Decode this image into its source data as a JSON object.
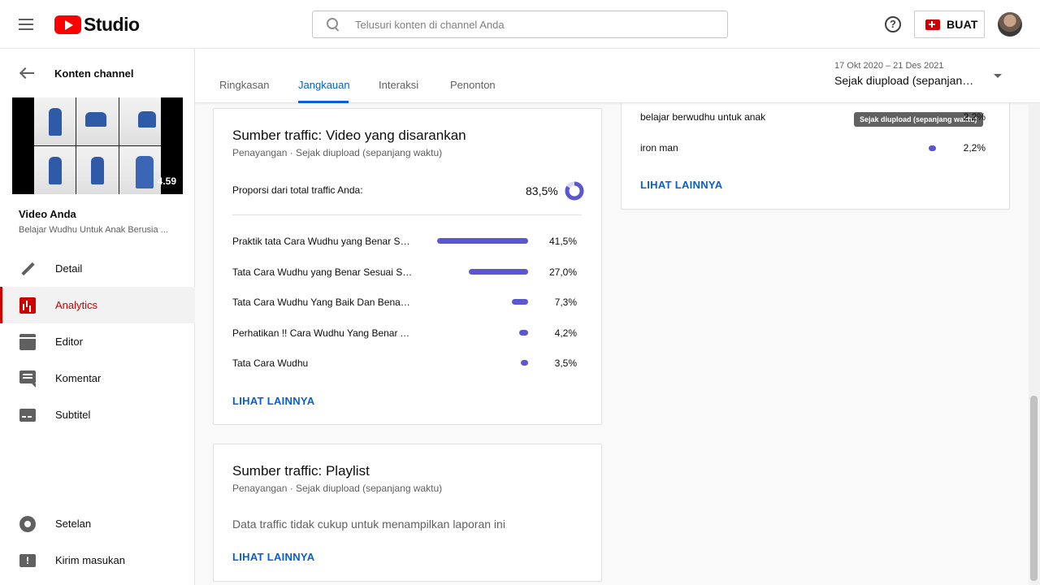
{
  "app": {
    "logo_text": "Studio"
  },
  "search": {
    "placeholder": "Telusuri konten di channel Anda"
  },
  "header": {
    "help": "?",
    "create_label": "BUAT"
  },
  "sidebar": {
    "back_label": "Konten channel",
    "thumbnail_duration": "4.59",
    "your_video_label": "Video Anda",
    "video_title": "Belajar Wudhu Untuk Anak Berusia ...",
    "items": [
      {
        "label": "Detail",
        "icon": "pencil-icon"
      },
      {
        "label": "Analytics",
        "icon": "analytics-icon"
      },
      {
        "label": "Editor",
        "icon": "editor-icon"
      },
      {
        "label": "Komentar",
        "icon": "comment-icon"
      },
      {
        "label": "Subtitel",
        "icon": "subtitle-icon"
      }
    ],
    "bottom_items": [
      {
        "label": "Setelan",
        "icon": "gear-icon"
      },
      {
        "label": "Kirim masukan",
        "icon": "feedback-icon"
      }
    ]
  },
  "tabs": [
    {
      "label": "Ringkasan"
    },
    {
      "label": "Jangkauan"
    },
    {
      "label": "Interaksi"
    },
    {
      "label": "Penonton"
    }
  ],
  "date_picker": {
    "range": "17 Okt 2020 – 21 Des 2021",
    "label": "Sejak diupload (sepanjang waktu)"
  },
  "suggested_card": {
    "title": "Sumber traffic: Video yang disarankan",
    "subtitle": "Penayangan · Sejak diupload (sepanjang waktu)",
    "proportion_label": "Proporsi dari total traffic Anda:",
    "proportion_value": "83,5%",
    "proportion_fraction": 0.835,
    "rows": [
      {
        "label": "Praktik tata Cara Wudhu yang Benar Se...",
        "value": "41,5%",
        "pct": 41.5
      },
      {
        "label": "Tata Cara Wudhu yang Benar Sesuai Su...",
        "value": "27,0%",
        "pct": 27.0
      },
      {
        "label": "Tata Cara Wudhu Yang Baik Dan Benar ...",
        "value": "7,3%",
        "pct": 7.3
      },
      {
        "label": "Perhatikan !! Cara Wudhu Yang Benar A...",
        "value": "4,2%",
        "pct": 4.2
      },
      {
        "label": "Tata Cara Wudhu",
        "value": "3,5%",
        "pct": 3.5
      }
    ],
    "link": "LIHAT LAINNYA"
  },
  "playlist_card": {
    "title": "Sumber traffic: Playlist",
    "subtitle": "Penayangan · Sejak diupload (sepanjang waktu)",
    "empty_message": "Data traffic tidak cukup untuk menampilkan laporan ini",
    "link": "LIHAT LAINNYA"
  },
  "search_terms_card": {
    "rows": [
      {
        "label": "belajar berwudhu untuk anak",
        "value": "2,2%"
      },
      {
        "label": "iron man",
        "value": "2,2%"
      }
    ],
    "tooltip": "Sejak diupload (sepanjang waktu)",
    "link": "LIHAT LAINNYA"
  },
  "colors": {
    "accent": "#065fd4",
    "bar": "#5b57d1",
    "active_nav": "#cc0000"
  }
}
